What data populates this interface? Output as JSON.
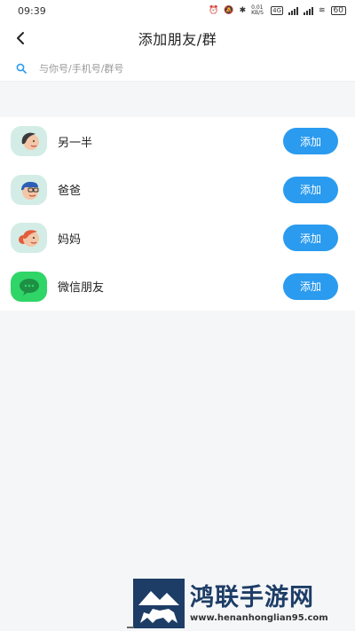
{
  "status": {
    "time": "09:39",
    "speed": "0.01 KB/S",
    "network": "4G",
    "battery": "60"
  },
  "nav": {
    "title": "添加朋友/群"
  },
  "search": {
    "placeholder": "与你号/手机号/群号"
  },
  "contacts": [
    {
      "name": "另一半",
      "button": "添加",
      "avatar": "person-dark-hair-icon",
      "avatar_bg": "#d3ede6"
    },
    {
      "name": "爸爸",
      "button": "添加",
      "avatar": "person-glasses-icon",
      "avatar_bg": "#d3ede6"
    },
    {
      "name": "妈妈",
      "button": "添加",
      "avatar": "person-red-hair-icon",
      "avatar_bg": "#d3ede6"
    },
    {
      "name": "微信朋友",
      "button": "添加",
      "avatar": "wechat-icon",
      "avatar_bg": "#2fd567"
    }
  ],
  "watermark": {
    "title": "鸿联手游网",
    "url": "www.henanhonglian95.com"
  },
  "colors": {
    "accent": "#2a9bef",
    "background": "#f5f6f8",
    "watermark_text": "#1d3d66"
  }
}
